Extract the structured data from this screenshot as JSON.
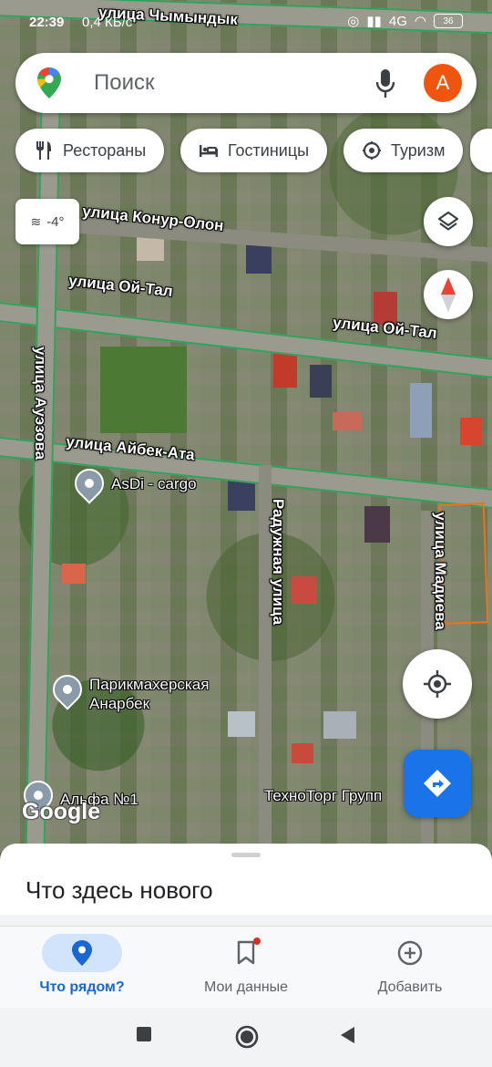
{
  "status_bar": {
    "time": "22:39",
    "net_speed": "0,4 КБ/с",
    "network": "4G",
    "battery": "36"
  },
  "search": {
    "placeholder": "Поиск",
    "avatar_letter": "А"
  },
  "chips": [
    {
      "label": "Рестораны",
      "icon": "restaurant-icon"
    },
    {
      "label": "Гостиницы",
      "icon": "hotel-icon"
    },
    {
      "label": "Туризм",
      "icon": "attraction-icon"
    }
  ],
  "weather": {
    "temp": "-4°",
    "icon": "haze-icon"
  },
  "map": {
    "streets": [
      "улица Чымындык",
      "улица Конур-Олон",
      "улица Ой-Тал",
      "улица Ой-Тал",
      "улица Ауэзова",
      "улица Айбек-Ата",
      "Радужная улица",
      "улица Мадиева"
    ],
    "places": [
      {
        "name": "AsDi - cargo"
      },
      {
        "name": "Парикмахерская Анарбек"
      },
      {
        "name": "Альфа №1"
      },
      {
        "name": "ТехноТорг Групп"
      }
    ],
    "attribution": "Google"
  },
  "sheet": {
    "title": "Что здесь нового"
  },
  "bottom_nav": [
    {
      "label": "Что рядом?",
      "icon": "explore-pin-icon",
      "active": true
    },
    {
      "label": "Мои данные",
      "icon": "bookmark-icon",
      "active": false
    },
    {
      "label": "Добавить",
      "icon": "add-circle-icon",
      "active": false
    }
  ],
  "colors": {
    "accent": "#1a73e8",
    "avatar": "#f0550f",
    "road_outline": "#2fa35c",
    "selected_parcel": "#e8741e"
  }
}
